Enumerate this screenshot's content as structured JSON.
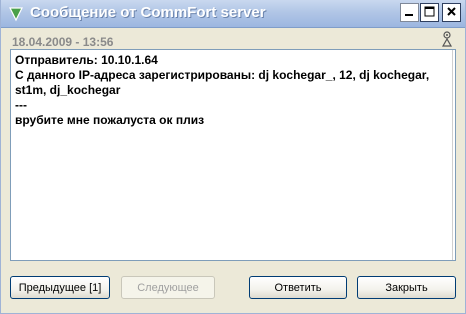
{
  "window": {
    "title": "Сообщение от CommFort server"
  },
  "header": {
    "date": "18.04.2009 - 13:56"
  },
  "message": {
    "lines": [
      "Отправитель: 10.10.1.64",
      "С данного IP-адреса зарегистрированы: dj kochegar_, 12, dj kochegar, st1m, dj_kochegar",
      "---",
      "врубите мне пожалуста ок плиз"
    ]
  },
  "buttons": {
    "previous": "Предыдущее [1]",
    "next": "Следующее",
    "reply": "Ответить",
    "close": "Закрыть"
  },
  "icons": {
    "app": "down-arrow-icon",
    "minimize": "minimize-icon",
    "maximize": "maximize-icon",
    "close": "close-icon",
    "sender": "person-icon"
  }
}
